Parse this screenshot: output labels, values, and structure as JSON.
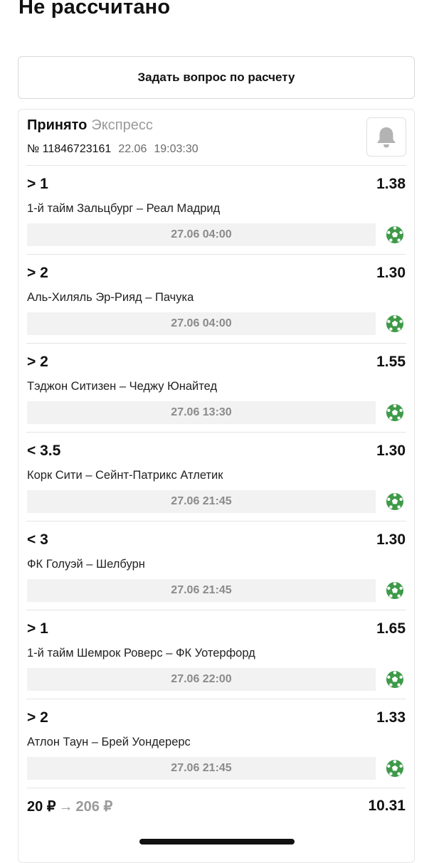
{
  "page": {
    "title": "Не рассчитано"
  },
  "ask_button": {
    "label": "Задать вопрос по расчету"
  },
  "ticket": {
    "status": "Принято",
    "type": "Экспресс",
    "number": "№ 11846723161",
    "date": "22.06",
    "time": "19:03:30",
    "bell_icon": "bell-icon"
  },
  "bets": [
    {
      "selection": "> 1",
      "odds": "1.38",
      "event": "1-й тайм Зальцбург – Реал Мадрид",
      "datetime": "27.06 04:00",
      "icon": "soccer-ball-icon"
    },
    {
      "selection": "> 2",
      "odds": "1.30",
      "event": "Аль-Хиляль Эр-Рияд – Пачука",
      "datetime": "27.06 04:00",
      "icon": "soccer-ball-icon"
    },
    {
      "selection": "> 2",
      "odds": "1.55",
      "event": "Тэджон Ситизен – Чеджу Юнайтед",
      "datetime": "27.06 13:30",
      "icon": "soccer-ball-icon"
    },
    {
      "selection": "< 3.5",
      "odds": "1.30",
      "event": "Корк Сити – Сейнт-Патрикс Атлетик",
      "datetime": "27.06 21:45",
      "icon": "soccer-ball-icon"
    },
    {
      "selection": "< 3",
      "odds": "1.30",
      "event": "ФК Голуэй – Шелбурн",
      "datetime": "27.06 21:45",
      "icon": "soccer-ball-icon"
    },
    {
      "selection": "> 1",
      "odds": "1.65",
      "event": "1-й тайм Шемрок Роверс – ФК Уотерфорд",
      "datetime": "27.06 22:00",
      "icon": "soccer-ball-icon"
    },
    {
      "selection": "> 2",
      "odds": "1.33",
      "event": "Атлон Таун – Брей Уондерерс",
      "datetime": "27.06 21:45",
      "icon": "soccer-ball-icon"
    }
  ],
  "summary": {
    "stake": "20 ₽",
    "arrow": "→",
    "potential_win": "206 ₽",
    "total_odds": "10.31"
  },
  "colors": {
    "ball_green": "#3e9a48",
    "muted_text": "#9a9a9a",
    "date_bg": "#f2f2f2"
  }
}
